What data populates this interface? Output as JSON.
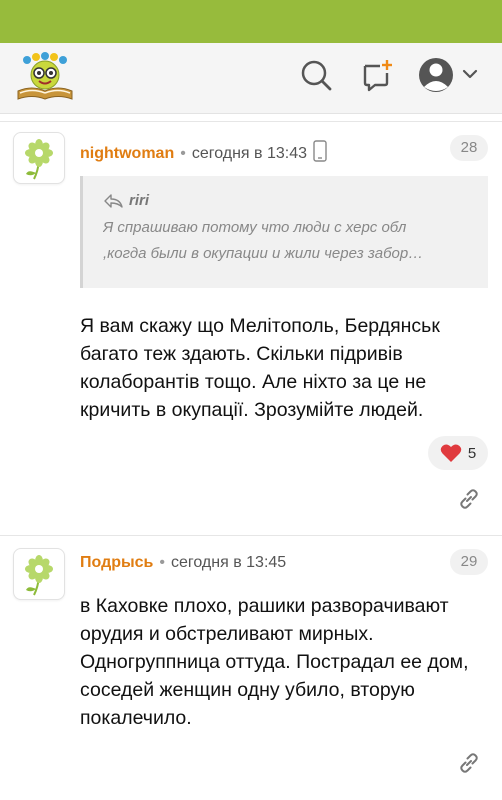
{
  "comments": [
    {
      "author": "nightwoman",
      "separator": "•",
      "time": "сегодня в 13:43",
      "number": "28",
      "quote_author": "riri",
      "quote_lines": [
        "Я спрашиваю потому что люди с херс обл",
        ",когда были в окупации и жили через забор…"
      ],
      "text": "Я вам скажу що Мелітополь, Бердянськ багато теж здають. Скільки підривів колаборантів тощо. Але ніхто за це не кричить в окупації. Зрозумійте людей.",
      "likes": "5"
    },
    {
      "author": "Подрысь",
      "separator": "•",
      "time": "сегодня в 13:45",
      "number": "29",
      "text": "в Каховке плохо, рашики разворачивают орудия и обстреливают мирных. Одногруппница оттуда. Пострадал ее дом, соседей женщин одну убило, вторую покалечило."
    }
  ],
  "icons": {
    "logo": "smiling-book-logo",
    "search": "search-icon",
    "new_post": "new-post-icon",
    "account": "user-avatar-icon",
    "dropdown": "chevron-down-icon",
    "device": "mobile-phone-icon",
    "reply": "reply-arrow-icon",
    "heart": "heart-icon",
    "link": "link-icon",
    "avatar": "flower-avatar"
  },
  "colors": {
    "topbar": "#97bb3c",
    "author": "#e07d12",
    "new_post_plus": "#f08a16",
    "heart": "#e03a3e"
  }
}
